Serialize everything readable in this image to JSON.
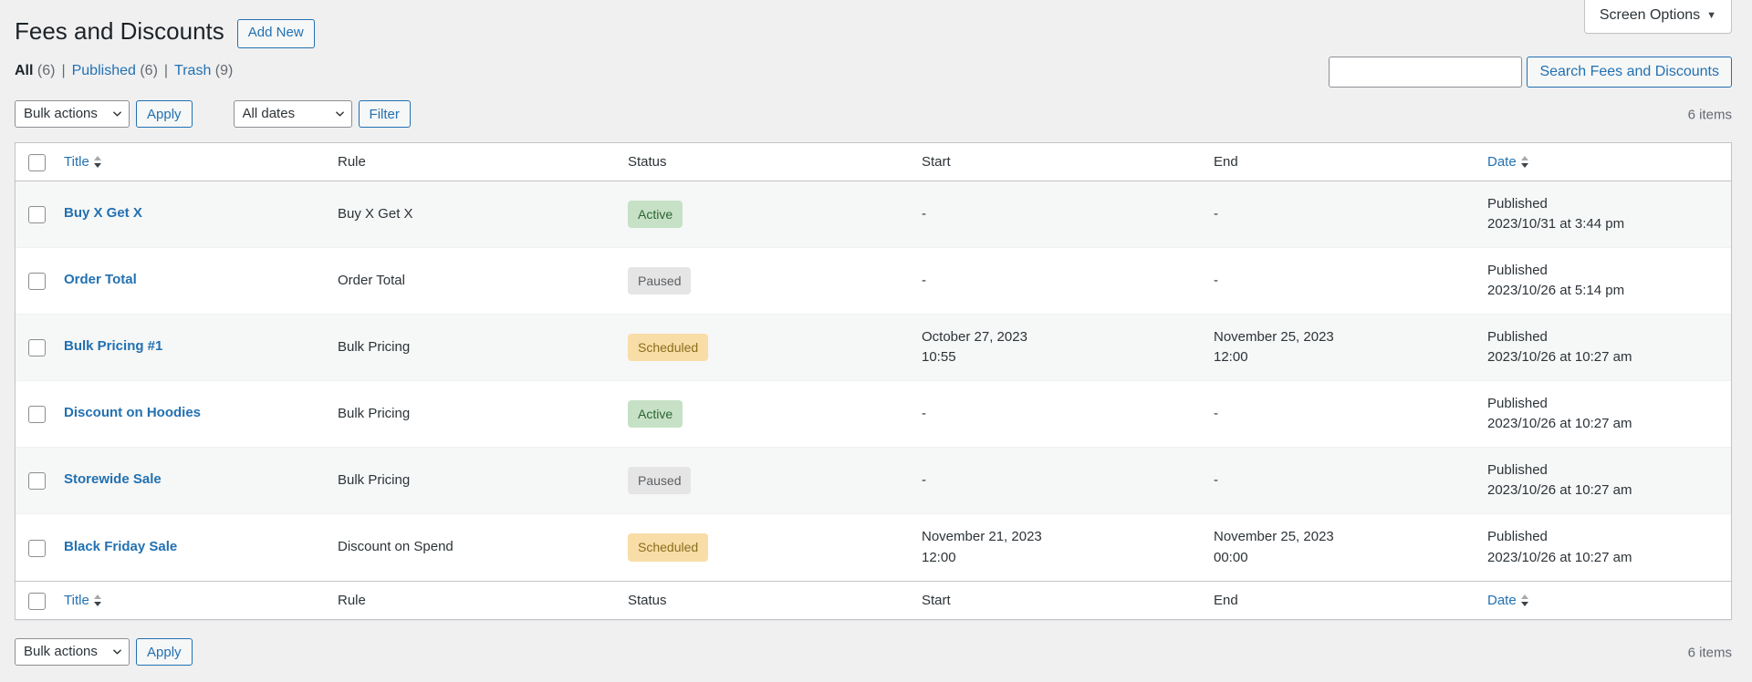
{
  "screen_meta": {
    "screen_options_label": "Screen Options",
    "caret_icon": "caret-down-icon"
  },
  "header": {
    "title": "Fees and Discounts",
    "add_new_label": "Add New"
  },
  "views": {
    "items": [
      {
        "label": "All",
        "count": "(6)",
        "current": true
      },
      {
        "label": "Published",
        "count": "(6)",
        "current": false
      },
      {
        "label": "Trash",
        "count": "(9)",
        "current": false
      }
    ],
    "separator": "|"
  },
  "search": {
    "value": "",
    "placeholder": "",
    "submit_label": "Search Fees and Discounts"
  },
  "tablenav_top": {
    "bulk_actions_label": "Bulk actions",
    "apply_label": "Apply",
    "all_dates_label": "All dates",
    "filter_label": "Filter",
    "displaying_num": "6 items"
  },
  "tablenav_bottom": {
    "bulk_actions_label": "Bulk actions",
    "apply_label": "Apply",
    "displaying_num": "6 items"
  },
  "table": {
    "columns": {
      "title": "Title",
      "rule": "Rule",
      "status": "Status",
      "start": "Start",
      "end": "End",
      "date": "Date"
    },
    "rows": [
      {
        "title": "Buy X Get X",
        "rule": "Buy X Get X",
        "status": "Active",
        "status_kind": "active",
        "start_date": "-",
        "start_time": "",
        "end_date": "-",
        "end_time": "",
        "date_status": "Published",
        "date_value": "2023/10/31 at 3:44 pm"
      },
      {
        "title": "Order Total",
        "rule": "Order Total",
        "status": "Paused",
        "status_kind": "paused",
        "start_date": "-",
        "start_time": "",
        "end_date": "-",
        "end_time": "",
        "date_status": "Published",
        "date_value": "2023/10/26 at 5:14 pm"
      },
      {
        "title": "Bulk Pricing #1",
        "rule": "Bulk Pricing",
        "status": "Scheduled",
        "status_kind": "scheduled",
        "start_date": "October 27, 2023",
        "start_time": "10:55",
        "end_date": "November 25, 2023",
        "end_time": "12:00",
        "date_status": "Published",
        "date_value": "2023/10/26 at 10:27 am"
      },
      {
        "title": "Discount on Hoodies",
        "rule": "Bulk Pricing",
        "status": "Active",
        "status_kind": "active",
        "start_date": "-",
        "start_time": "",
        "end_date": "-",
        "end_time": "",
        "date_status": "Published",
        "date_value": "2023/10/26 at 10:27 am"
      },
      {
        "title": "Storewide Sale",
        "rule": "Bulk Pricing",
        "status": "Paused",
        "status_kind": "paused",
        "start_date": "-",
        "start_time": "",
        "end_date": "-",
        "end_time": "",
        "date_status": "Published",
        "date_value": "2023/10/26 at 10:27 am"
      },
      {
        "title": "Black Friday Sale",
        "rule": "Discount on Spend",
        "status": "Scheduled",
        "status_kind": "scheduled",
        "start_date": "November 21, 2023",
        "start_time": "12:00",
        "end_date": "November 25, 2023",
        "end_time": "00:00",
        "date_status": "Published",
        "date_value": "2023/10/26 at 10:27 am"
      }
    ]
  },
  "colors": {
    "link": "#2271b1",
    "page_bg": "#f0f0f1",
    "row_alt_bg": "#f6f7f7",
    "status_active_bg": "#c6e1c6",
    "status_active_fg": "#2e6331",
    "status_paused_bg": "#e5e5e5",
    "status_paused_fg": "#5c5f62",
    "status_scheduled_bg": "#f8dda7",
    "status_scheduled_fg": "#8a6d1c"
  }
}
